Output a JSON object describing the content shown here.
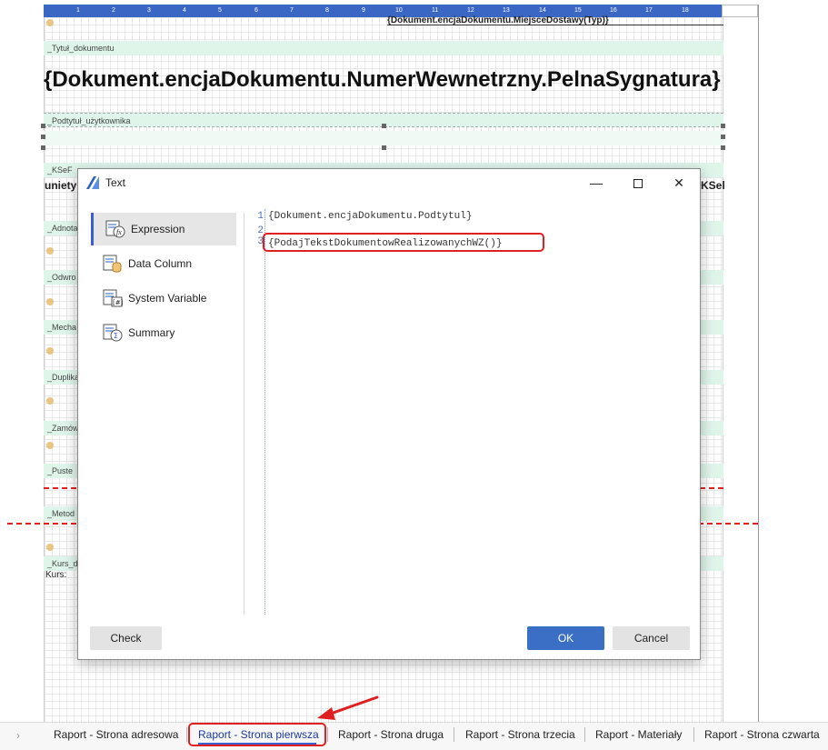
{
  "designer": {
    "ruler_marks": [
      "1",
      "2",
      "3",
      "4",
      "5",
      "6",
      "7",
      "8",
      "9",
      "10",
      "11",
      "12",
      "13",
      "14",
      "15",
      "16",
      "17",
      "18"
    ],
    "top_field": "{Dokument.encjaDokumentu.MiejsceDostawy(Typ)}",
    "bands": {
      "tytul": "_Tytuł_dokumentu",
      "podtytul": "_Podtytuł_użytkownika",
      "ksef": "_KSeF",
      "adnotacje": "_Adnota",
      "odwrotne": "_Odwro",
      "mechanizm": "_Mecha",
      "duplikat": "_Duplika",
      "zamowienie": "_Zamów",
      "puste": "_Puste",
      "metoda": "_Metod",
      "kurs": "_Kurs_d"
    },
    "big_title": "{Dokument.encjaDokumentu.NumerWewnetrzny.PelnaSygnatura}",
    "ksef_left_text": "uniety",
    "ksef_right_text": "KSel",
    "kurs_label": "Kurs:"
  },
  "dialog": {
    "title": "Text",
    "nav": [
      {
        "label": "Expression",
        "icon": "expression-icon",
        "active": true
      },
      {
        "label": "Data Column",
        "icon": "data-column-icon",
        "active": false
      },
      {
        "label": "System Variable",
        "icon": "system-variable-icon",
        "active": false
      },
      {
        "label": "Summary",
        "icon": "summary-icon",
        "active": false
      }
    ],
    "editor": {
      "line_numbers": [
        "1",
        "2",
        "3"
      ],
      "lines": [
        "{Dokument.encjaDokumentu.Podtytul}",
        "",
        "{PodajTekstDokumentowRealizowanychWZ()}"
      ]
    },
    "buttons": {
      "check": "Check",
      "ok": "OK",
      "cancel": "Cancel"
    }
  },
  "tabs": [
    {
      "label": "Raport - Strona adresowa",
      "active": false
    },
    {
      "label": "Raport - Strona pierwsza",
      "active": true
    },
    {
      "label": "Raport - Strona druga",
      "active": false
    },
    {
      "label": "Raport - Strona trzecia",
      "active": false
    },
    {
      "label": "Raport - Materiały",
      "active": false
    },
    {
      "label": "Raport - Strona czwarta",
      "active": false
    }
  ],
  "colors": {
    "accent": "#3b6fc5",
    "highlight": "#e02020",
    "band": "#dff5ea",
    "ruler": "#3a66c4"
  }
}
